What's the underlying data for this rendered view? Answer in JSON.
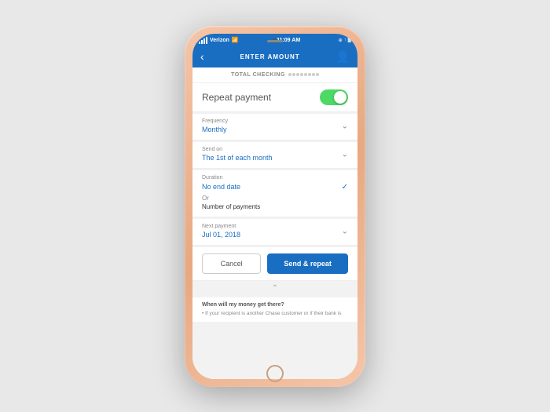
{
  "phone": {
    "status_bar": {
      "carrier": "Verizon",
      "time": "11:09 AM",
      "battery": "100%"
    },
    "nav": {
      "title": "ENTER AMOUNT",
      "back_label": "‹"
    },
    "account": {
      "label": "TOTAL CHECKING",
      "mask": "••••••••"
    },
    "repeat_payment": {
      "label": "Repeat payment",
      "toggle_on": true
    },
    "frequency": {
      "label": "Frequency",
      "value": "Monthly"
    },
    "send_on": {
      "label": "Send on",
      "value": "The 1st of each month"
    },
    "duration": {
      "label": "Duration",
      "no_end_date": "No end date",
      "or_label": "Or",
      "number_label": "Number of payments"
    },
    "next_payment": {
      "label": "Next payment",
      "value": "Jul 01, 2018"
    },
    "buttons": {
      "cancel": "Cancel",
      "send_repeat": "Send & repeat"
    },
    "footer": {
      "question": "When will my money get there?",
      "detail": "• If your recipient is another Chase customer or if their bank is"
    }
  }
}
